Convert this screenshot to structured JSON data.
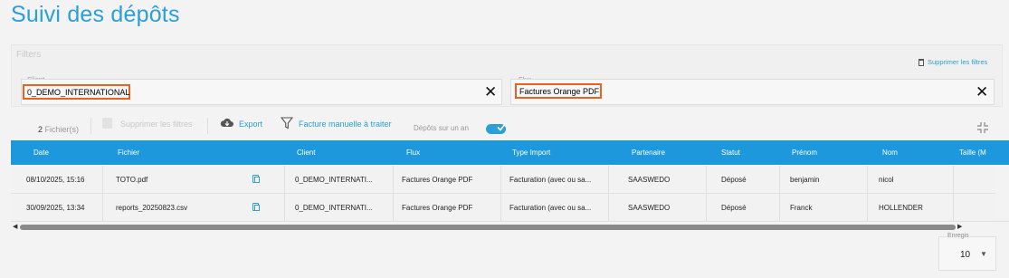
{
  "page": {
    "title": "Suivi des dépôts"
  },
  "filters": {
    "title": "Filters",
    "clear_label": "Supprimer les filtres",
    "client": {
      "label": "Client",
      "value": "0_DEMO_INTERNATIONAL",
      "clear": "✕"
    },
    "flux": {
      "label": "Flux",
      "value": "Factures Orange PDF",
      "clear": "✕"
    }
  },
  "toolbar": {
    "file_count": "2",
    "file_count_label": "Fichier(s)",
    "delete_filters_label": "Supprimer les filtres",
    "export_label": "Export",
    "manual_invoice_label": "Facture manuelle à traiter",
    "deposits_toggle_label": "Dépôts sur un an",
    "deposits_toggle_on": true
  },
  "table": {
    "columns": [
      "Date",
      "Fichier",
      "Client",
      "Flux",
      "Type Import",
      "Partenaire",
      "Statut",
      "Prénom",
      "Nom",
      "Taille (M"
    ],
    "rows": [
      [
        "08/10/2025, 15:16",
        "TOTO.pdf",
        "0_DEMO_INTERNATI...",
        "Factures Orange PDF",
        "Facturation (avec ou sa...",
        "SAASWEDO",
        "Déposé",
        "benjamin",
        "nicol",
        ""
      ],
      [
        "30/09/2025, 13:34",
        "reports_20250823.csv",
        "0_DEMO_INTERNATI...",
        "Factures Orange PDF",
        "Facturation (avec ou sa...",
        "SAASWEDO",
        "Déposé",
        "Franck",
        "HOLLENDER",
        ""
      ]
    ]
  },
  "pagination": {
    "page_size_label": "Enregis",
    "page_size": "10"
  },
  "colors": {
    "accent": "#2a9fd8",
    "header": "#1e98dd",
    "highlight": "#e8631f"
  }
}
